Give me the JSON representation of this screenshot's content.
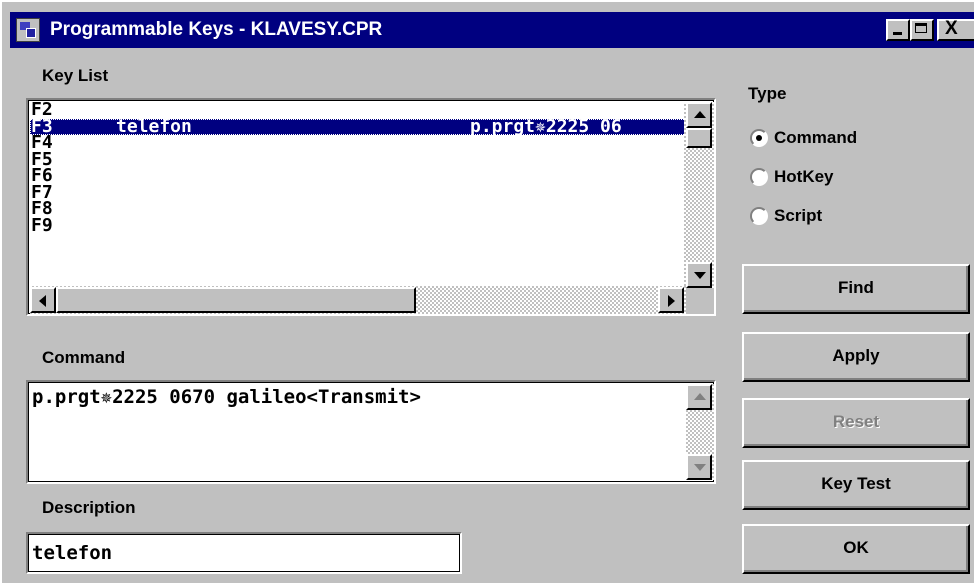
{
  "window": {
    "title": "Programmable Keys - KLAVESY.CPR",
    "close_glyph": "X"
  },
  "key_list": {
    "label": "Key List",
    "items": [
      {
        "key": "F2",
        "name": "",
        "command": ""
      },
      {
        "key": "F3",
        "name": "telefon",
        "command": "p.prgt✵2225 06",
        "selected": true
      },
      {
        "key": "F4",
        "name": "",
        "command": ""
      },
      {
        "key": "F5",
        "name": "",
        "command": ""
      },
      {
        "key": "F6",
        "name": "",
        "command": ""
      },
      {
        "key": "F7",
        "name": "",
        "command": ""
      },
      {
        "key": "F8",
        "name": "",
        "command": ""
      },
      {
        "key": "F9",
        "name": "",
        "command": ""
      }
    ]
  },
  "command": {
    "label": "Command",
    "value": "p.prgt✵2225 0670 galileo<Transmit>"
  },
  "description": {
    "label": "Description",
    "value": "telefon"
  },
  "type": {
    "label": "Type",
    "options": [
      "Command",
      "HotKey",
      "Script"
    ],
    "selected": "Command"
  },
  "buttons": {
    "find": "Find",
    "apply": "Apply",
    "reset": "Reset",
    "key_test": "Key Test",
    "ok": "OK"
  },
  "icons": {
    "app": "app-icon",
    "minimize": "minimize-icon",
    "maximize": "maximize-icon",
    "close": "close-icon"
  }
}
